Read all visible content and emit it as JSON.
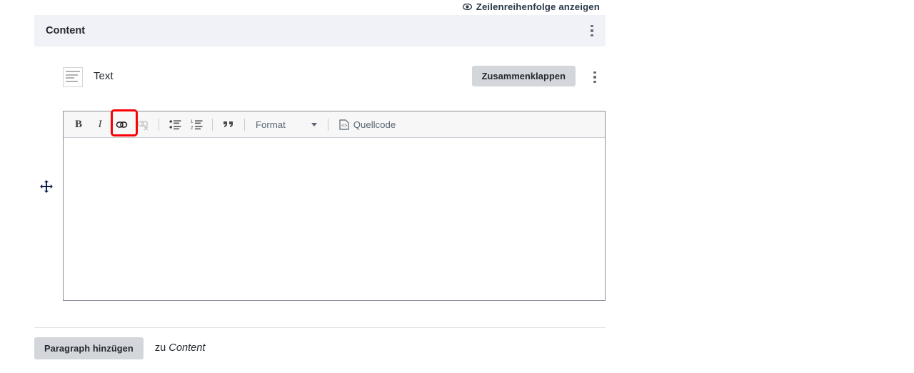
{
  "top_link": {
    "icon": "eye-icon",
    "label": "Zeilenreihenfolge anzeigen"
  },
  "content_section": {
    "title": "Content",
    "menu_icon": "vertical-ellipsis-icon"
  },
  "drag_handle": {
    "icon": "move-cross-icon"
  },
  "paragraph": {
    "type_icon": "text-block-icon",
    "label": "Text",
    "collapse_label": "Zusammenklappen",
    "menu_icon": "vertical-ellipsis-icon"
  },
  "editor": {
    "toolbar": [
      {
        "name": "bold-button",
        "glyph": "B",
        "kind": "bold",
        "disabled": false
      },
      {
        "name": "italic-button",
        "glyph": "I",
        "kind": "italic",
        "disabled": false
      },
      {
        "name": "link-button",
        "glyph": "",
        "kind": "link",
        "disabled": false,
        "highlighted": true
      },
      {
        "name": "unlink-button",
        "glyph": "",
        "kind": "unlink",
        "disabled": true
      },
      {
        "name": "bulleted-list-button",
        "glyph": "",
        "kind": "ul",
        "disabled": false
      },
      {
        "name": "numbered-list-button",
        "glyph": "",
        "kind": "ol",
        "disabled": false
      },
      {
        "name": "blockquote-button",
        "glyph": "”",
        "kind": "quote",
        "disabled": false
      }
    ],
    "format_label": "Format",
    "source_label": "Quellcode",
    "body_value": "",
    "body_placeholder": ""
  },
  "footer": {
    "add_label": "Paragraph hinzügen",
    "suffix_prefix": "zu",
    "suffix_target": "Content"
  },
  "colors": {
    "highlight": "#fb0007",
    "header_bg": "#f0f2f7",
    "button_bg": "#d3d6da",
    "toolbar_bg": "#f7f7f7",
    "text": "#23292f"
  }
}
